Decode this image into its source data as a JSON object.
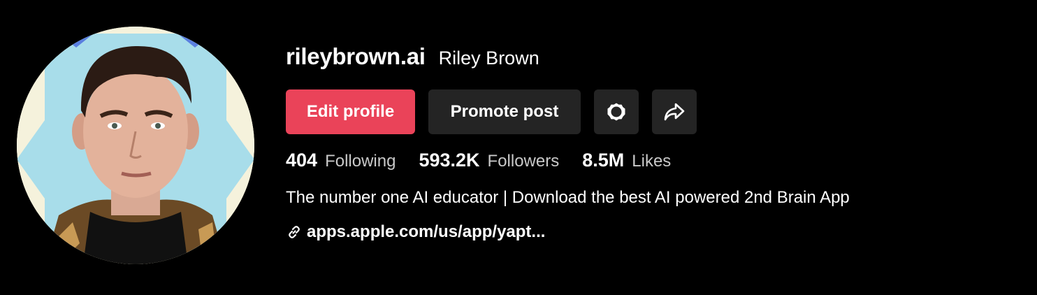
{
  "profile": {
    "username": "rileybrown.ai",
    "nickname": "Riley Brown",
    "avatar_icon": "profile-photo",
    "actions": {
      "edit_label": "Edit profile",
      "promote_label": "Promote post",
      "settings_icon": "gear-icon",
      "share_icon": "share-icon"
    },
    "stats": [
      {
        "value": "404",
        "label": "Following"
      },
      {
        "value": "593.2K",
        "label": "Followers"
      },
      {
        "value": "8.5M",
        "label": "Likes"
      }
    ],
    "bio": "The number one AI educator | Download the best AI powered 2nd Brain App",
    "link": {
      "icon": "link-icon",
      "text": "apps.apple.com/us/app/yapt..."
    }
  },
  "colors": {
    "background": "#000000",
    "primary_button": "#ea4359",
    "secondary_button": "#242424",
    "muted_text": "#c9c9c9"
  }
}
